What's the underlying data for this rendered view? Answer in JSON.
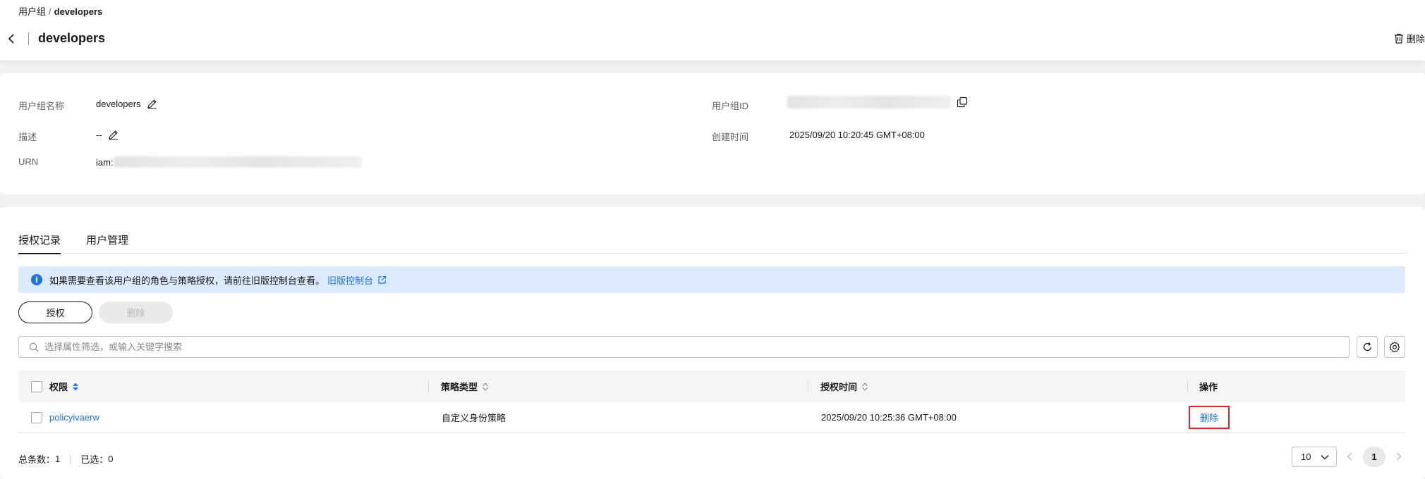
{
  "breadcrumb": {
    "parent": "用户组",
    "separator": "/",
    "current": "developers"
  },
  "header": {
    "title": "developers",
    "delete_label": "删除"
  },
  "info": {
    "name_label": "用户组名称",
    "name_value": "developers",
    "desc_label": "描述",
    "desc_value": "--",
    "urn_label": "URN",
    "urn_prefix": "iam:",
    "id_label": "用户组ID",
    "created_label": "创建时间",
    "created_value": "2025/09/20 10:20:45 GMT+08:00"
  },
  "tabs": [
    {
      "label": "授权记录",
      "active": true
    },
    {
      "label": "用户管理",
      "active": false
    }
  ],
  "notice": {
    "text": "如果需要查看该用户组的角色与策略授权，请前往旧版控制台查看。",
    "link": "旧版控制台"
  },
  "toolbar": {
    "grant_label": "授权",
    "delete_label": "删除"
  },
  "search": {
    "placeholder": "选择属性筛选，或输入关键字搜索"
  },
  "table": {
    "columns": [
      "权限",
      "策略类型",
      "授权时间",
      "操作"
    ],
    "rows": [
      {
        "permission": "policyivaerw",
        "type": "自定义身份策略",
        "time": "2025/09/20 10:25:36 GMT+08:00",
        "action": "删除"
      }
    ]
  },
  "footer": {
    "total_label": "总条数：",
    "total_value": "1",
    "selected_label": "已选：",
    "selected_value": "0",
    "page_size": "10",
    "current_page": "1"
  },
  "colors": {
    "link": "#1e75e0",
    "highlight_border": "#e0262b",
    "notice_bg": "#dbeafc"
  }
}
